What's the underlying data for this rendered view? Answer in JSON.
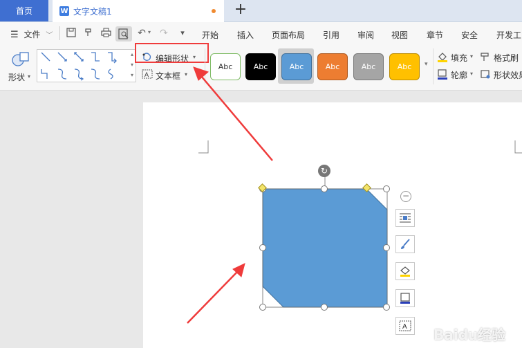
{
  "tabs": {
    "home": "首页",
    "doc_title": "文字文稿1",
    "doc_icon": "W",
    "new_tab": "+"
  },
  "menu": {
    "file": "文件",
    "items": [
      "开始",
      "插入",
      "页面布局",
      "引用",
      "审阅",
      "视图",
      "章节",
      "安全",
      "开发工"
    ]
  },
  "ribbon": {
    "shape_label": "形状",
    "edit_shape": "编辑形状",
    "text_box": "文本框",
    "fill": "填充",
    "format_brush": "格式刷",
    "outline": "轮廓",
    "shape_effect": "形状效果",
    "styles": [
      {
        "label": "Abc",
        "bg": "#ffffff",
        "fg": "#333333",
        "border": "#7dbb63"
      },
      {
        "label": "Abc",
        "bg": "#000000",
        "fg": "#ffffff",
        "border": "#000000"
      },
      {
        "label": "Abc",
        "bg": "#5b9bd5",
        "fg": "#ffffff",
        "border": "#41719c"
      },
      {
        "label": "Abc",
        "bg": "#ed7d31",
        "fg": "#ffffff",
        "border": "#ae5a21"
      },
      {
        "label": "Abc",
        "bg": "#a5a5a5",
        "fg": "#ffffff",
        "border": "#787878"
      },
      {
        "label": "Abc",
        "bg": "#ffc000",
        "fg": "#ffffff",
        "border": "#bc8c00"
      }
    ]
  },
  "colors": {
    "accent": "#3f6fd1",
    "shape_fill": "#5b9bd5",
    "annotation_red": "#ef3b3b"
  },
  "watermark": "Baidu经验"
}
